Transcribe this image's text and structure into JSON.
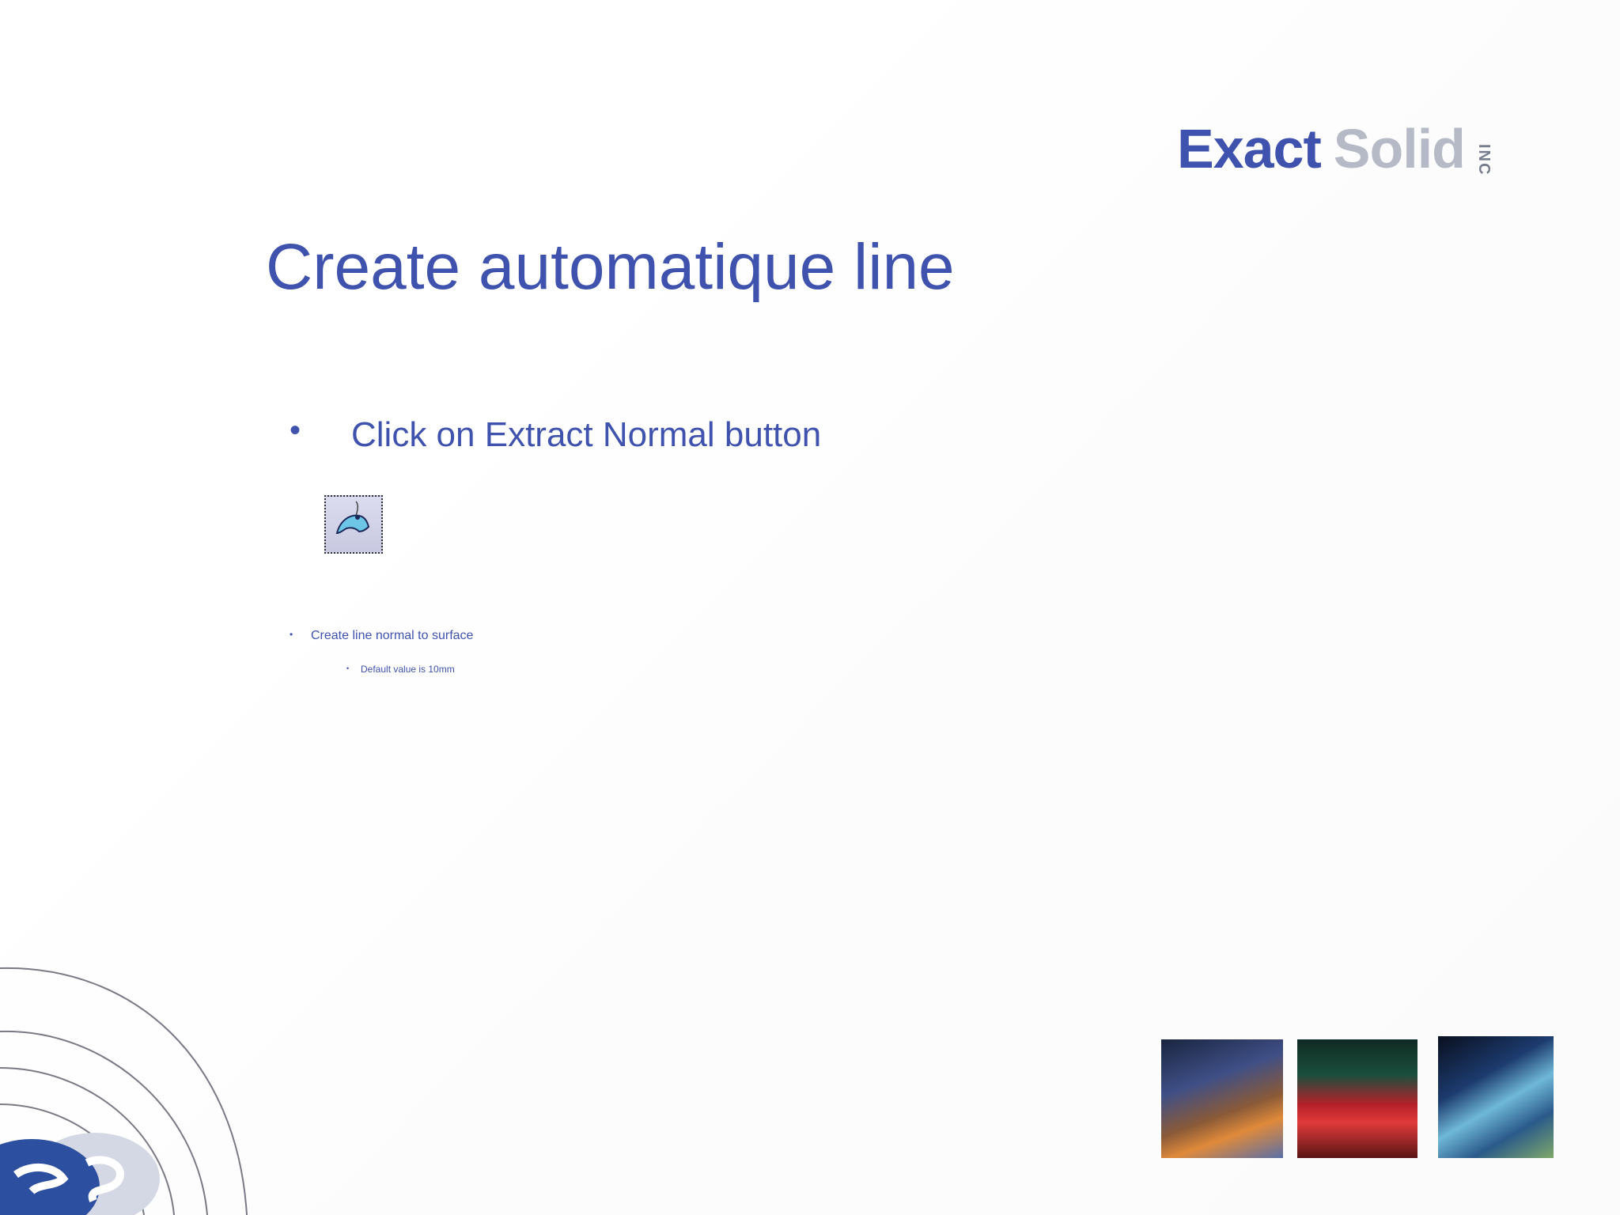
{
  "logo": {
    "word1": "Exact",
    "word2": "Solid",
    "suffix": "INC",
    "colors": {
      "exact": "#3f53ae",
      "solid": "#b5bac6",
      "inc": "#777d8e"
    }
  },
  "slide": {
    "title": "Create automatique line",
    "bullets": [
      {
        "marker": "•",
        "text": "Click on Extract Normal button"
      },
      {
        "marker": "•",
        "text": "Create line normal to surface"
      }
    ],
    "sub_bullets": [
      {
        "marker": "•",
        "text": "Default value is 10mm"
      }
    ],
    "accent_color": "#3f53ae"
  },
  "tool_button": {
    "icon": "extract-normal-icon"
  },
  "decor": {
    "corner_logo_icon": "es-swirl-logo-icon",
    "photos": [
      "cnc-tool-photo",
      "machined-surface-photo",
      "milling-spindle-photo"
    ]
  }
}
